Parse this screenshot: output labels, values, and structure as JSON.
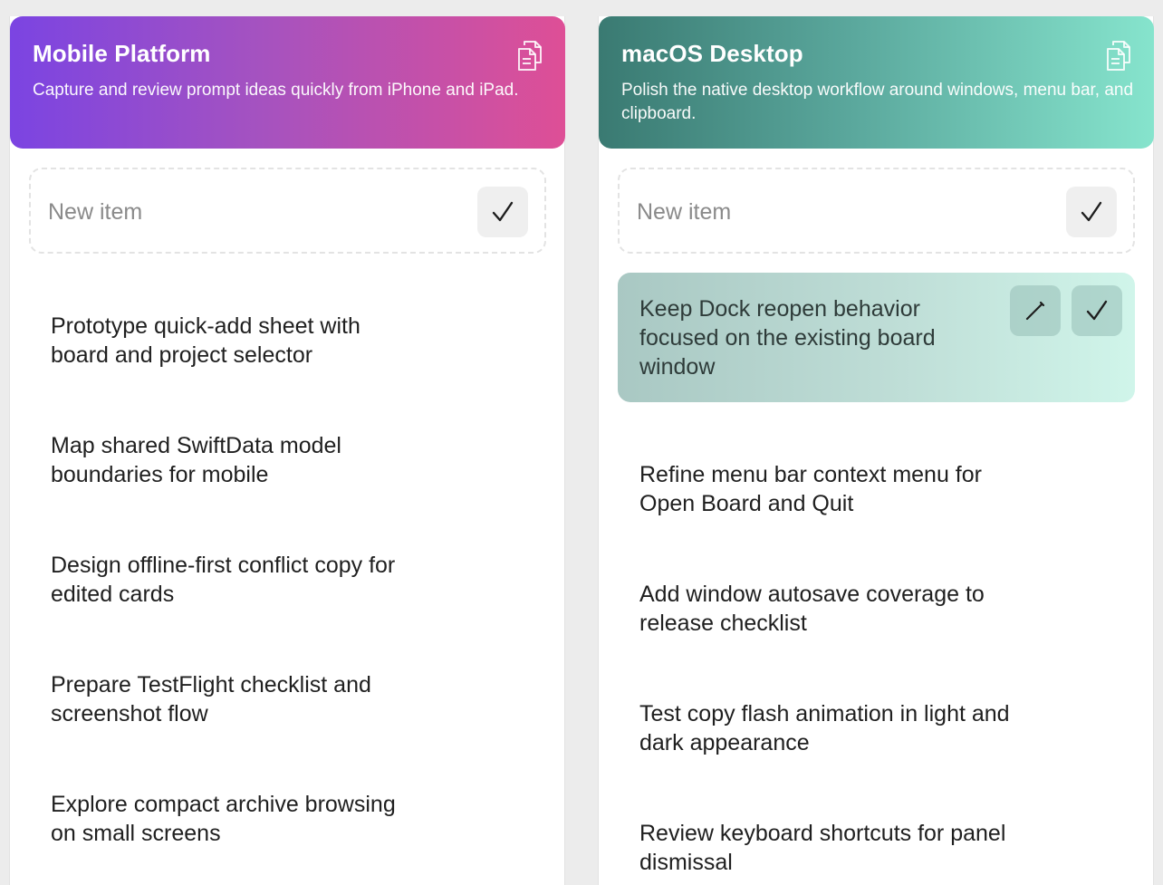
{
  "columns": [
    {
      "title": "Mobile Platform",
      "description": "Capture and review prompt ideas quickly from iPhone and iPad.",
      "copy_icon": "copy-icon",
      "new_item_placeholder": "New item",
      "items": [
        {
          "text": "Prototype quick-add sheet with board and project selector"
        },
        {
          "text": "Map shared SwiftData model boundaries for mobile"
        },
        {
          "text": "Design offline-first conflict copy for edited cards"
        },
        {
          "text": "Prepare TestFlight checklist and screenshot flow"
        },
        {
          "text": "Explore compact archive browsing on small screens"
        }
      ]
    },
    {
      "title": "macOS Desktop",
      "description": "Polish the native desktop workflow around windows, menu bar, and clipboard.",
      "copy_icon": "copy-icon",
      "new_item_placeholder": "New item",
      "items": [
        {
          "text": "Keep Dock reopen behavior focused on the existing board window",
          "highlighted": true
        },
        {
          "text": "Refine menu bar context menu for Open Board and Quit"
        },
        {
          "text": "Add window autosave coverage to release checklist"
        },
        {
          "text": "Test copy flash animation in light and dark appearance"
        },
        {
          "text": "Review keyboard shortcuts for panel dismissal"
        }
      ]
    }
  ],
  "colors": {
    "mobile_gradient_start": "#7b44e2",
    "mobile_gradient_end": "#de4f96",
    "macos_gradient_start": "#3a7a72",
    "macos_gradient_end": "#86e4cd",
    "highlight_item": "#bfded7"
  }
}
